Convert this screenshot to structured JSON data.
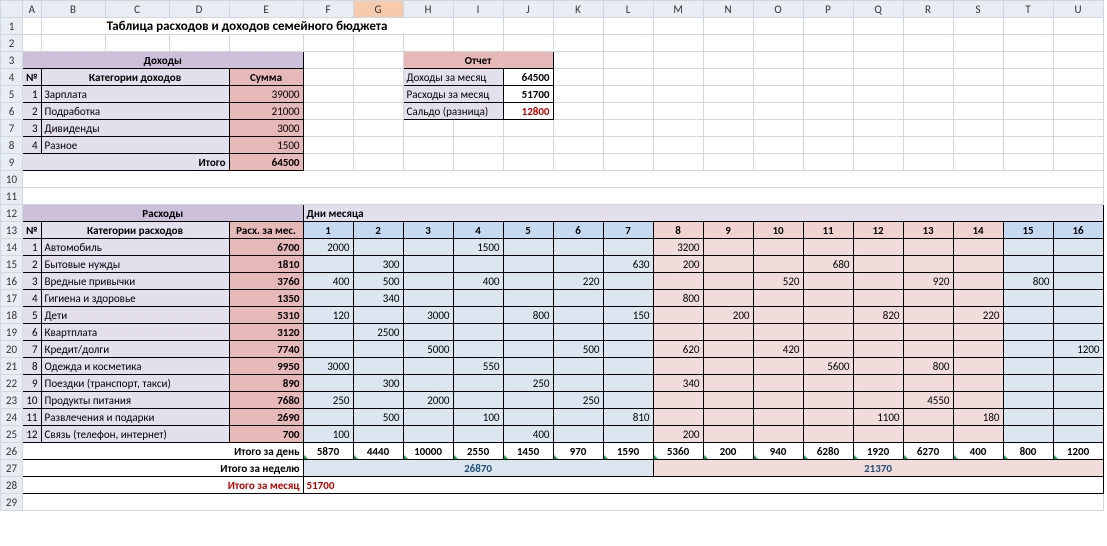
{
  "selectedColumn": "G",
  "title": "Таблица расходов и доходов семейного бюджета",
  "income": {
    "heading": "Доходы",
    "colNum": "№",
    "colCat": "Категории доходов",
    "colSum": "Сумма",
    "rows": [
      {
        "n": 1,
        "cat": "Зарплата",
        "sum": 39000
      },
      {
        "n": 2,
        "cat": "Подработка",
        "sum": 21000
      },
      {
        "n": 3,
        "cat": "Дивиденды",
        "sum": 3000
      },
      {
        "n": 4,
        "cat": "Разное",
        "sum": 1500
      }
    ],
    "totalLabel": "Итого",
    "total": 64500
  },
  "report": {
    "heading": "Отчет",
    "rows": [
      {
        "label": "Доходы за месяц",
        "value": 64500,
        "red": false
      },
      {
        "label": "Расходы за месяц",
        "value": 51700,
        "red": false
      },
      {
        "label": "Сальдо (разница)",
        "value": 12800,
        "red": true
      }
    ]
  },
  "expenses": {
    "heading": "Расходы",
    "daysHeading": "Дни месяца",
    "colNum": "№",
    "colCat": "Категории расходов",
    "colMonth": "Расх. за мес.",
    "days": [
      1,
      2,
      3,
      4,
      5,
      6,
      7,
      8,
      9,
      10,
      11,
      12,
      13,
      14,
      15,
      16
    ],
    "rows": [
      {
        "n": 1,
        "cat": "Автомобиль",
        "sum": 6700,
        "d": [
          2000,
          null,
          null,
          1500,
          null,
          null,
          null,
          3200,
          null,
          null,
          null,
          null,
          null,
          null,
          null,
          null
        ]
      },
      {
        "n": 2,
        "cat": "Бытовые нужды",
        "sum": 1810,
        "d": [
          null,
          300,
          null,
          null,
          null,
          null,
          630,
          200,
          null,
          null,
          680,
          null,
          null,
          null,
          null,
          null
        ]
      },
      {
        "n": 3,
        "cat": "Вредные привычки",
        "sum": 3760,
        "d": [
          400,
          500,
          null,
          400,
          null,
          220,
          null,
          null,
          null,
          520,
          null,
          null,
          920,
          null,
          800,
          null
        ]
      },
      {
        "n": 4,
        "cat": "Гигиена и здоровье",
        "sum": 1350,
        "d": [
          null,
          340,
          null,
          null,
          null,
          null,
          null,
          800,
          null,
          null,
          null,
          null,
          null,
          null,
          null,
          null
        ]
      },
      {
        "n": 5,
        "cat": "Дети",
        "sum": 5310,
        "d": [
          120,
          null,
          3000,
          null,
          800,
          null,
          150,
          null,
          200,
          null,
          null,
          820,
          null,
          220,
          null,
          null
        ]
      },
      {
        "n": 6,
        "cat": "Квартплата",
        "sum": 3120,
        "d": [
          null,
          2500,
          null,
          null,
          null,
          null,
          null,
          null,
          null,
          null,
          null,
          null,
          null,
          null,
          null,
          null
        ]
      },
      {
        "n": 7,
        "cat": "Кредит/долги",
        "sum": 7740,
        "d": [
          null,
          null,
          5000,
          null,
          null,
          500,
          null,
          620,
          null,
          420,
          null,
          null,
          null,
          null,
          null,
          1200
        ]
      },
      {
        "n": 8,
        "cat": "Одежда и косметика",
        "sum": 9950,
        "d": [
          3000,
          null,
          null,
          550,
          null,
          null,
          null,
          null,
          null,
          null,
          5600,
          null,
          800,
          null,
          null,
          null
        ]
      },
      {
        "n": 9,
        "cat": "Поездки (транспорт, такси)",
        "sum": 890,
        "d": [
          null,
          300,
          null,
          null,
          250,
          null,
          null,
          340,
          null,
          null,
          null,
          null,
          null,
          null,
          null,
          null
        ]
      },
      {
        "n": 10,
        "cat": "Продукты питания",
        "sum": 7680,
        "d": [
          250,
          null,
          2000,
          null,
          null,
          250,
          null,
          null,
          null,
          null,
          null,
          null,
          4550,
          null,
          null,
          null
        ]
      },
      {
        "n": 11,
        "cat": "Развлечения и подарки",
        "sum": 2690,
        "d": [
          null,
          500,
          null,
          100,
          null,
          null,
          810,
          null,
          null,
          null,
          null,
          1100,
          null,
          180,
          null,
          null
        ]
      },
      {
        "n": 12,
        "cat": "Связь (телефон, интернет)",
        "sum": 700,
        "d": [
          100,
          null,
          null,
          null,
          400,
          null,
          null,
          200,
          null,
          null,
          null,
          null,
          null,
          null,
          null,
          null
        ]
      }
    ],
    "dayTotalLabel": "Итого за день",
    "dayTotals": [
      5870,
      4440,
      10000,
      2550,
      1450,
      970,
      1590,
      5360,
      200,
      940,
      6280,
      1920,
      6270,
      400,
      800,
      1200
    ],
    "weekTotalLabel": "Итого за неделю",
    "weekTotals": [
      26870,
      21370
    ],
    "monthTotalLabel": "Итого за месяц",
    "monthTotal": 51700
  }
}
